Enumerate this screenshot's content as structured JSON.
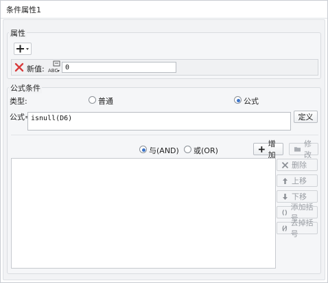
{
  "window": {
    "title": "条件属性1"
  },
  "attr_group": {
    "legend": "属性",
    "new_value_label": "新值:",
    "new_value": "0",
    "abc_icon": "abc-formula-icon",
    "delete_icon": "red-x-icon",
    "add_icon": "plus-dropdown-icon"
  },
  "formula_group": {
    "legend": "公式条件",
    "type_label": "类型:",
    "type_options": [
      {
        "label": "普通",
        "selected": false
      },
      {
        "label": "公式",
        "selected": true
      }
    ],
    "formula_label": "公式=",
    "formula_value": "isnull(D6)",
    "define_button": "定义",
    "logic_options": [
      {
        "label": "与(AND)",
        "selected": true
      },
      {
        "label": "或(OR)",
        "selected": false
      }
    ],
    "add_button": "增加",
    "modify_button": "修改",
    "side_buttons": [
      {
        "label": "删除",
        "icon": "x-icon",
        "enabled": false
      },
      {
        "label": "上移",
        "icon": "arrow-up-icon",
        "enabled": false
      },
      {
        "label": "下移",
        "icon": "arrow-down-icon",
        "enabled": false
      },
      {
        "label": "添加括号",
        "icon": "parentheses-icon",
        "enabled": false
      },
      {
        "label": "去掉括号",
        "icon": "remove-parentheses-icon",
        "enabled": false
      }
    ]
  },
  "colors": {
    "accent": "#3b73c8",
    "delete_red": "#d83b3b",
    "border": "#c6c9ce"
  }
}
